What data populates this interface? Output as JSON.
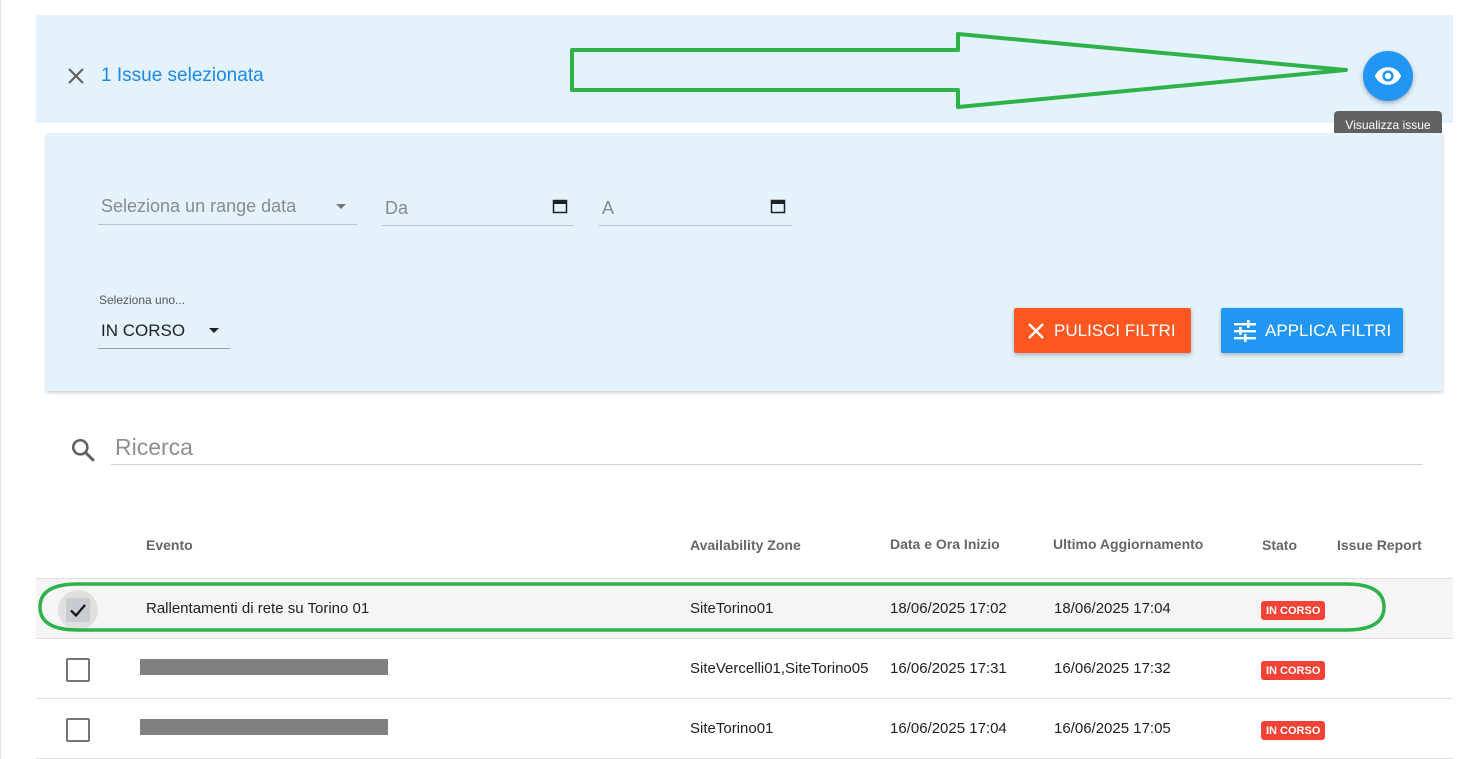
{
  "selection_bar": {
    "text": "1 Issue selezionata",
    "view_tooltip": "Visualizza issue"
  },
  "filters": {
    "range_placeholder": "Seleziona un range data",
    "from_placeholder": "Da",
    "to_placeholder": "A",
    "status_label": "Seleziona uno...",
    "status_value": "IN CORSO",
    "clear_button": "PULISCI FILTRI",
    "apply_button": "APPLICA FILTRI"
  },
  "search": {
    "placeholder": "Ricerca"
  },
  "table": {
    "headers": {
      "evento": "Evento",
      "zone": "Availability Zone",
      "start": "Data e Ora Inizio",
      "updated": "Ultimo Aggiornamento",
      "stato": "Stato",
      "report": "Issue Report"
    },
    "rows": [
      {
        "checked": true,
        "evento": "Rallentamenti di rete su Torino 01",
        "zone": "SiteTorino01",
        "start": "18/06/2025 17:02",
        "updated": "18/06/2025 17:04",
        "stato": "IN CORSO"
      },
      {
        "checked": false,
        "evento": "",
        "zone": "SiteVercelli01,SiteTorino05",
        "start": "16/06/2025 17:31",
        "updated": "16/06/2025 17:32",
        "stato": "IN CORSO"
      },
      {
        "checked": false,
        "evento": "",
        "zone": "SiteTorino01",
        "start": "16/06/2025 17:04",
        "updated": "16/06/2025 17:05",
        "stato": "IN CORSO"
      }
    ]
  },
  "colors": {
    "accent_blue": "#2196f3",
    "clear_orange": "#ff5722",
    "status_red": "#f44336",
    "annotation_green": "#2fb24a",
    "panel_bg": "#e3f2fd"
  },
  "icons": {
    "close": "close-icon",
    "view": "eye-icon",
    "search": "search-icon",
    "calendar": "calendar-icon",
    "tune": "tune-icon"
  }
}
